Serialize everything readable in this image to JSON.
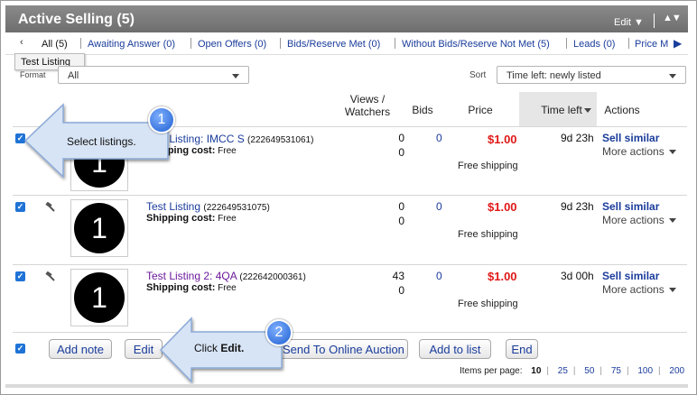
{
  "header": {
    "title": "Active Selling (5)",
    "edit_label": "Edit"
  },
  "tabs": [
    {
      "label": "All (5)"
    },
    {
      "label": "Awaiting Answer (0)"
    },
    {
      "label": "Open Offers (0)"
    },
    {
      "label": "Bids/Reserve Met (0)"
    },
    {
      "label": "Without Bids/Reserve Not Met (5)"
    },
    {
      "label": "Leads (0)"
    },
    {
      "label": "Price M"
    }
  ],
  "tooltip": "Test Listing",
  "filters": {
    "format_label": "Format",
    "format_value": "All",
    "sort_label": "Sort",
    "sort_value": "Time left: newly listed"
  },
  "columns": {
    "views": "Views /",
    "watchers": "Watchers",
    "bids": "Bids",
    "price": "Price",
    "time_left": "Time left",
    "actions": "Actions"
  },
  "listings": [
    {
      "title": "Test Listing: IMCC S",
      "item_id": "(222649531061)",
      "shipping_label": "Shipping cost:",
      "shipping_value": "Free",
      "views": "0",
      "watchers": "0",
      "bids": "0",
      "price": "$1.00",
      "free_shipping": "Free shipping",
      "time_left": "9d 23h",
      "sell_similar": "Sell similar",
      "more_actions": "More actions",
      "thumb_text": "1"
    },
    {
      "title": "Test Listing",
      "item_id": "(222649531075)",
      "shipping_label": "Shipping cost:",
      "shipping_value": "Free",
      "views": "0",
      "watchers": "0",
      "bids": "0",
      "price": "$1.00",
      "free_shipping": "Free shipping",
      "time_left": "9d 23h",
      "sell_similar": "Sell similar",
      "more_actions": "More actions",
      "thumb_text": "1"
    },
    {
      "title": "Test Listing 2: 4QA",
      "item_id": "(222642000361)",
      "shipping_label": "Shipping cost:",
      "shipping_value": "Free",
      "views": "43",
      "watchers": "0",
      "bids": "0",
      "price": "$1.00",
      "free_shipping": "Free shipping",
      "time_left": "3d 00h",
      "sell_similar": "Sell similar",
      "more_actions": "More actions",
      "thumb_text": "1"
    }
  ],
  "buttons": {
    "add_note": "Add note",
    "edit": "Edit",
    "send_auction": "Send To Online Auction",
    "add_to_list": "Add to list",
    "end": "End"
  },
  "pagination": {
    "label": "Items per page:",
    "options": [
      "10",
      "25",
      "50",
      "75",
      "100",
      "200"
    ],
    "selected": "10"
  },
  "callouts": [
    {
      "number": "1",
      "text": "Select listings."
    },
    {
      "number": "2",
      "text_prefix": "Click ",
      "text_bold": "Edit."
    }
  ],
  "colors": {
    "header_bg": "#7a7a7a",
    "link": "#1a3c9b",
    "price": "#e01818",
    "checkbox": "#1f73d6",
    "callout_arrow": "#d7e4f5"
  }
}
